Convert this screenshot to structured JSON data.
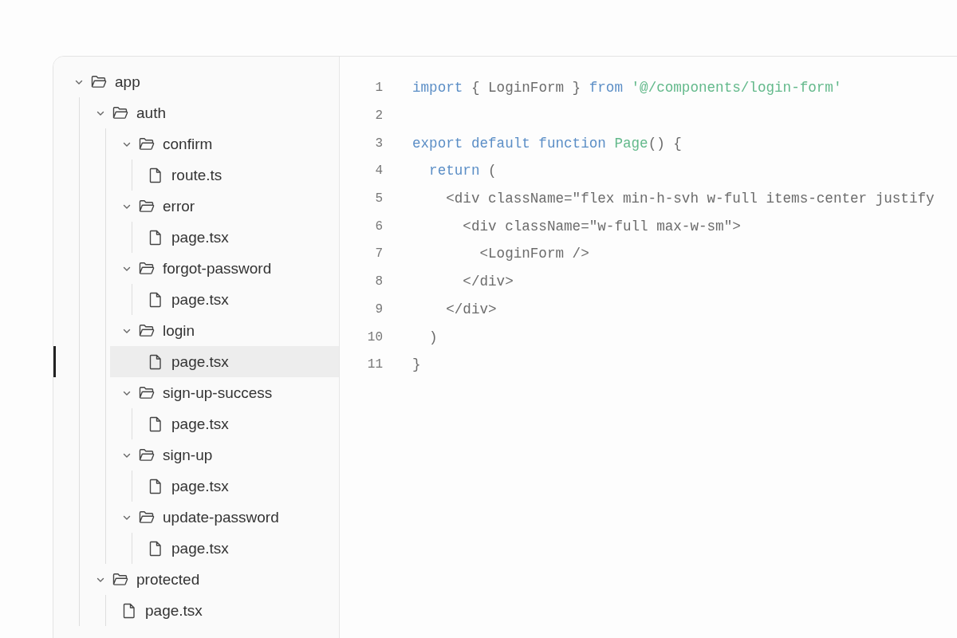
{
  "file_tree": [
    {
      "name": "app",
      "kind": "folder",
      "expanded": true,
      "selected": false,
      "children": [
        {
          "name": "auth",
          "kind": "folder",
          "expanded": true,
          "selected": false,
          "children": [
            {
              "name": "confirm",
              "kind": "folder",
              "expanded": true,
              "selected": false,
              "children": [
                {
                  "name": "route.ts",
                  "kind": "file",
                  "selected": false
                }
              ]
            },
            {
              "name": "error",
              "kind": "folder",
              "expanded": true,
              "selected": false,
              "children": [
                {
                  "name": "page.tsx",
                  "kind": "file",
                  "selected": false
                }
              ]
            },
            {
              "name": "forgot-password",
              "kind": "folder",
              "expanded": true,
              "selected": false,
              "children": [
                {
                  "name": "page.tsx",
                  "kind": "file",
                  "selected": false
                }
              ]
            },
            {
              "name": "login",
              "kind": "folder",
              "expanded": true,
              "selected": false,
              "children": [
                {
                  "name": "page.tsx",
                  "kind": "file",
                  "selected": true
                }
              ]
            },
            {
              "name": "sign-up-success",
              "kind": "folder",
              "expanded": true,
              "selected": false,
              "children": [
                {
                  "name": "page.tsx",
                  "kind": "file",
                  "selected": false
                }
              ]
            },
            {
              "name": "sign-up",
              "kind": "folder",
              "expanded": true,
              "selected": false,
              "children": [
                {
                  "name": "page.tsx",
                  "kind": "file",
                  "selected": false
                }
              ]
            },
            {
              "name": "update-password",
              "kind": "folder",
              "expanded": true,
              "selected": false,
              "children": [
                {
                  "name": "page.tsx",
                  "kind": "file",
                  "selected": false
                }
              ]
            }
          ]
        },
        {
          "name": "protected",
          "kind": "folder",
          "expanded": true,
          "selected": false,
          "children": [
            {
              "name": "page.tsx",
              "kind": "file",
              "selected": false
            }
          ]
        }
      ]
    }
  ],
  "code_lines": [
    {
      "number": "1",
      "tokens": [
        {
          "kind": "keyword",
          "text": "import"
        },
        {
          "kind": "plain",
          "text": " { LoginForm } "
        },
        {
          "kind": "keyword",
          "text": "from"
        },
        {
          "kind": "string",
          "text": " '@/components/login-form'"
        }
      ]
    },
    {
      "number": "2"
    },
    {
      "number": "3",
      "tokens": [
        {
          "kind": "keyword",
          "text": "export default function"
        },
        {
          "kind": "function",
          "text": " Page"
        },
        {
          "kind": "plain",
          "text": "() {"
        }
      ]
    },
    {
      "number": "4",
      "tokens": [
        {
          "kind": "keyword",
          "text": "  return"
        },
        {
          "kind": "plain",
          "text": " ("
        }
      ]
    },
    {
      "number": "5",
      "tokens": [
        {
          "kind": "plain",
          "text": "    <div className=\"flex min-h-svh w-full items-center justify"
        }
      ]
    },
    {
      "number": "6",
      "tokens": [
        {
          "kind": "plain",
          "text": "      <div className=\"w-full max-w-sm\">"
        }
      ]
    },
    {
      "number": "7",
      "tokens": [
        {
          "kind": "plain",
          "text": "        <LoginForm />"
        }
      ]
    },
    {
      "number": "8",
      "tokens": [
        {
          "kind": "plain",
          "text": "      </div>"
        }
      ]
    },
    {
      "number": "9",
      "tokens": [
        {
          "kind": "plain",
          "text": "    </div>"
        }
      ]
    },
    {
      "number": "10",
      "tokens": [
        {
          "kind": "plain",
          "text": "  )"
        }
      ]
    },
    {
      "number": "11",
      "tokens": [
        {
          "kind": "plain",
          "text": "}"
        }
      ]
    }
  ]
}
